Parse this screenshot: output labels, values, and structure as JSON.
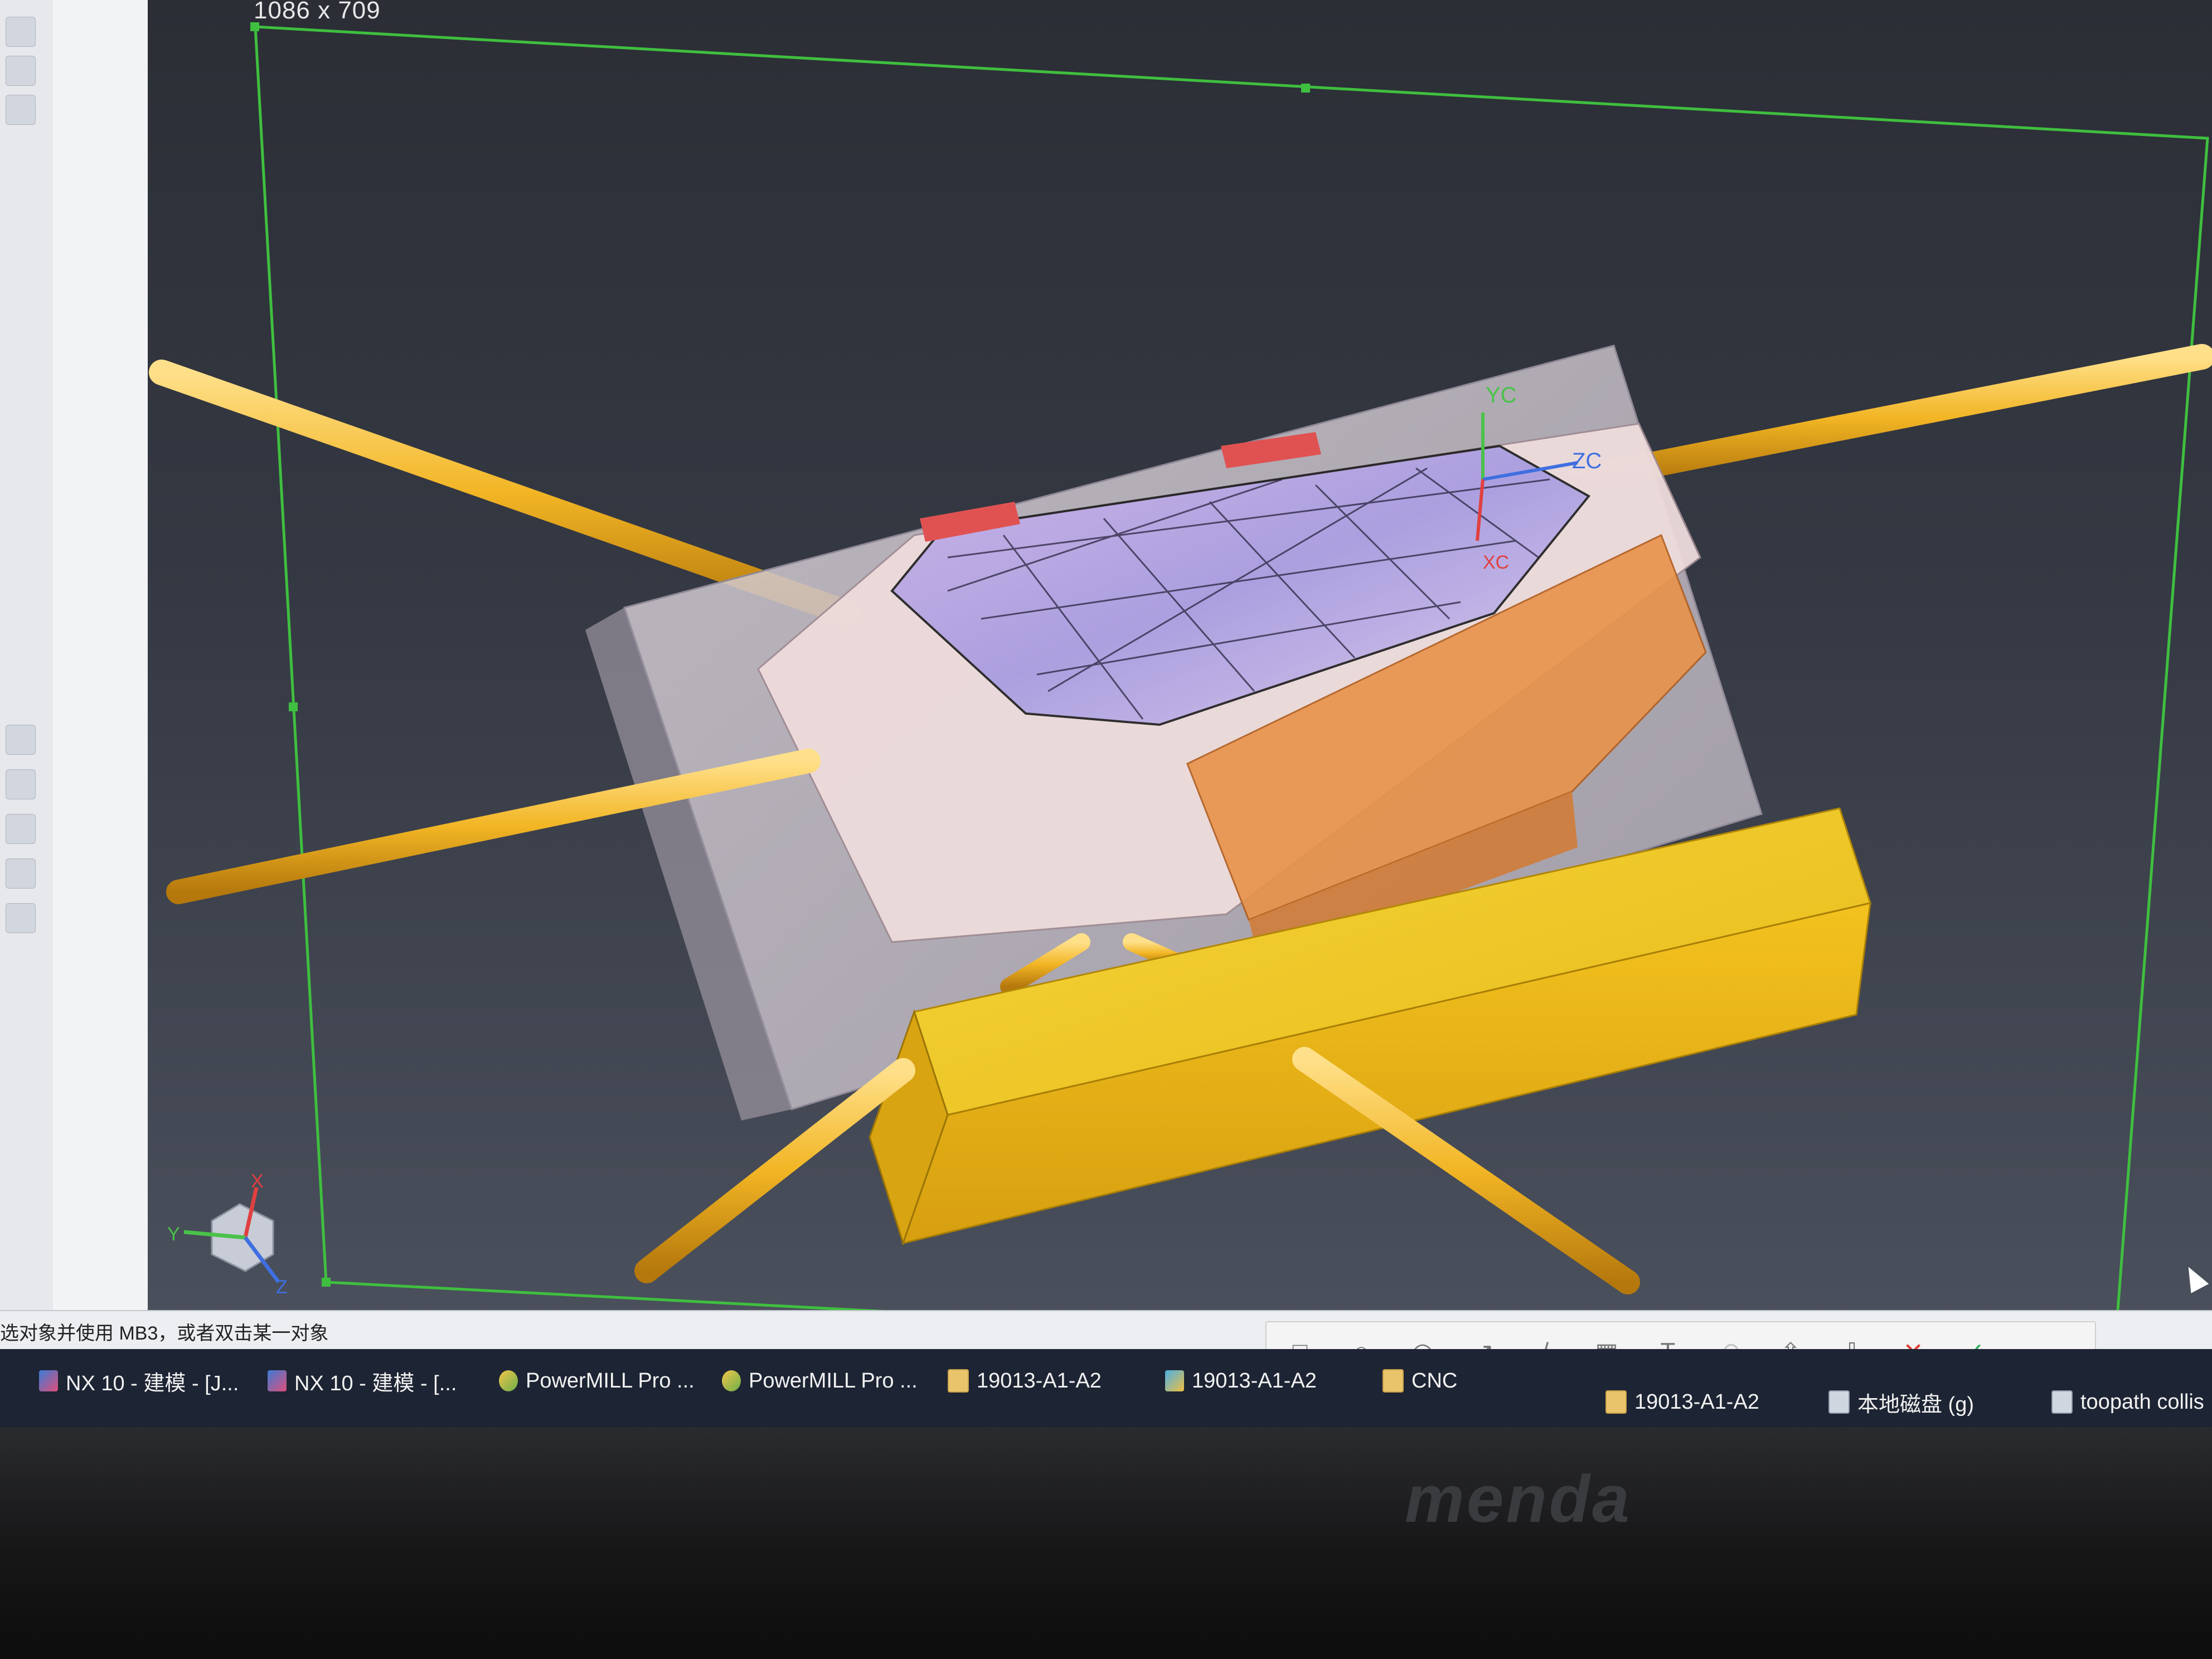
{
  "viewport": {
    "size_label": "1086 x 709",
    "csys_labels": {
      "yc": "YC",
      "zc": "ZC",
      "xc": "XC"
    },
    "triad_labels": {
      "x": "X",
      "y": "Y",
      "z": "Z"
    }
  },
  "status_bar": {
    "text": "选对象并使用 MB3，或者双击某一对象"
  },
  "taskbar": {
    "items": [
      {
        "label": "NX 10 - 建模 - [J...",
        "icon": "nx-icon"
      },
      {
        "label": "NX 10 - 建模 - [...",
        "icon": "nx-icon"
      },
      {
        "label": "PowerMILL Pro ...",
        "icon": "powermill-icon"
      },
      {
        "label": "PowerMILL Pro ...",
        "icon": "powermill-icon"
      },
      {
        "label": "19013-A1-A2",
        "icon": "folder-icon"
      },
      {
        "label": "19013-A1-A2",
        "icon": "image-icon"
      },
      {
        "label": "CNC",
        "icon": "folder-icon"
      },
      {
        "label": "19013-A1-A2",
        "icon": "folder-icon"
      },
      {
        "label": "本地磁盘 (g)",
        "icon": "drive-icon"
      },
      {
        "label": "toopath collis",
        "icon": "file-icon"
      }
    ]
  },
  "annotation_toolbar": {
    "tools": [
      {
        "name": "rectangle-tool",
        "glyph": "□"
      },
      {
        "name": "ellipse-tool",
        "glyph": "○"
      },
      {
        "name": "mosaic-tool",
        "glyph": "◎"
      },
      {
        "name": "arrow-tool",
        "glyph": "↗"
      },
      {
        "name": "pen-tool",
        "glyph": "/"
      },
      {
        "name": "blur-tool",
        "glyph": "▦"
      },
      {
        "name": "text-tool",
        "glyph": "T"
      },
      {
        "name": "undo-tool",
        "glyph": "↶"
      },
      {
        "name": "share-tool",
        "glyph": "⇪"
      },
      {
        "name": "download-tool",
        "glyph": "⇩"
      },
      {
        "name": "cancel-tool",
        "glyph": "✕"
      },
      {
        "name": "confirm-tool",
        "glyph": "✓"
      }
    ]
  },
  "monitor": {
    "brand": "menda"
  },
  "colors": {
    "viewport_bg": "#353943",
    "pin_yellow": "#f2b524",
    "block_yellow": "#f2c220",
    "frame_green": "#3fbf3f",
    "mold_orange": "#e8934a",
    "cavity_purple": "#a79be0"
  }
}
